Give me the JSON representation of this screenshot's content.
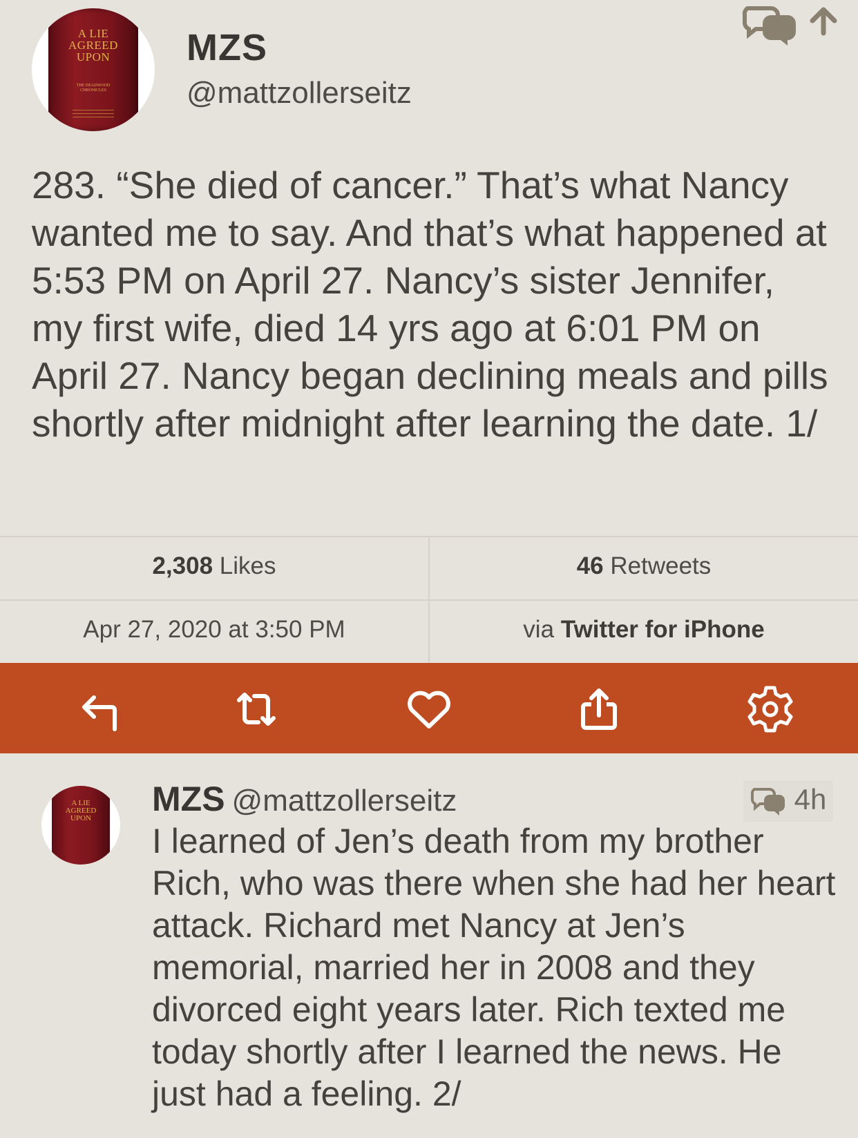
{
  "main_tweet": {
    "avatar_book": {
      "title_line1": "A LIE",
      "title_line2": "AGREED",
      "title_line3": "UPON",
      "subtitle_line1": "THE DEADWOOD",
      "subtitle_line2": "CHRONICLES"
    },
    "name": "MZS",
    "handle": "@mattzollerseitz",
    "text": "283. “She died of cancer.” That’s what Nancy wanted me to say. And that’s what happened at 5:53 PM on April 27. Nancy’s sister Jennifer, my first wife, died 14 yrs ago at 6:01 PM on April 27. Nancy began declining meals and pills shortly after midnight after learning the date. 1/",
    "likes_count": "2,308",
    "likes_label": "Likes",
    "retweets_count": "46",
    "retweets_label": "Retweets",
    "timestamp": "Apr 27, 2020 at 3:50 PM",
    "via_prefix": "via",
    "via_client": "Twitter for iPhone"
  },
  "top_icons": [
    "conversation-icon",
    "arrow-up-icon"
  ],
  "action_bar": {
    "color": "#bf4c20",
    "buttons": [
      "reply-icon",
      "retweet-icon",
      "like-icon",
      "share-icon",
      "settings-icon"
    ]
  },
  "reply_tweet": {
    "avatar_book": {
      "title_line1": "A LIE",
      "title_line2": "AGREED",
      "title_line3": "UPON"
    },
    "name": "MZS",
    "handle": "@mattzollerseitz",
    "time": "4h",
    "text": "I learned of Jen’s death from my brother Rich, who was there when she had her heart attack. Richard met Nancy at Jen’s memorial, married her in 2008 and they divorced eight years later. Rich texted me today shortly after I learned the news. He just had a feeling. 2/"
  }
}
